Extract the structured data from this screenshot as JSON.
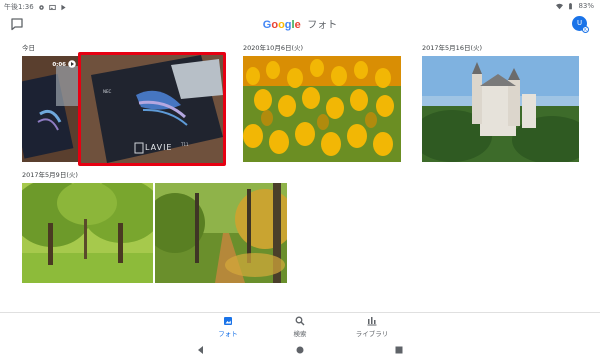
{
  "status_bar": {
    "time": "午後1:36",
    "battery": "83%",
    "icons": [
      "settings-icon",
      "gallery-icon",
      "play-store-icon",
      "wifi-icon",
      "battery-icon"
    ]
  },
  "header": {
    "logo_letters": [
      "G",
      "o",
      "o",
      "g",
      "l",
      "e"
    ],
    "logo_colors": [
      "#4285f4",
      "#ea4335",
      "#fbbc05",
      "#4285f4",
      "#34a853",
      "#ea4335"
    ],
    "product_name": "フォト",
    "avatar_letter": "U",
    "avatar_badge": "K"
  },
  "groups": [
    {
      "date": "今日",
      "photos": [
        "video-laptop",
        "laptop-box-selected"
      ]
    },
    {
      "date": "2020年10月6日(火)",
      "photos": [
        "tulips"
      ]
    },
    {
      "date": "2017年5月16日(火)",
      "photos": [
        "castle"
      ]
    },
    {
      "date": "2017年5月9日(火)",
      "photos": [
        "park-trees",
        "forest-path"
      ]
    }
  ],
  "video_thumb": {
    "duration": "0:06"
  },
  "laptop_box_text": {
    "brand": "LAVIE",
    "model": "T11",
    "badge": "NEC"
  },
  "bottom_nav": [
    {
      "label": "フォト",
      "icon": "photo-icon",
      "active": true
    },
    {
      "label": "検索",
      "icon": "search-icon",
      "active": false
    },
    {
      "label": "ライブラリ",
      "icon": "library-icon",
      "active": false
    }
  ],
  "colors": {
    "accent": "#1a73e8",
    "selection": "#e60012"
  }
}
